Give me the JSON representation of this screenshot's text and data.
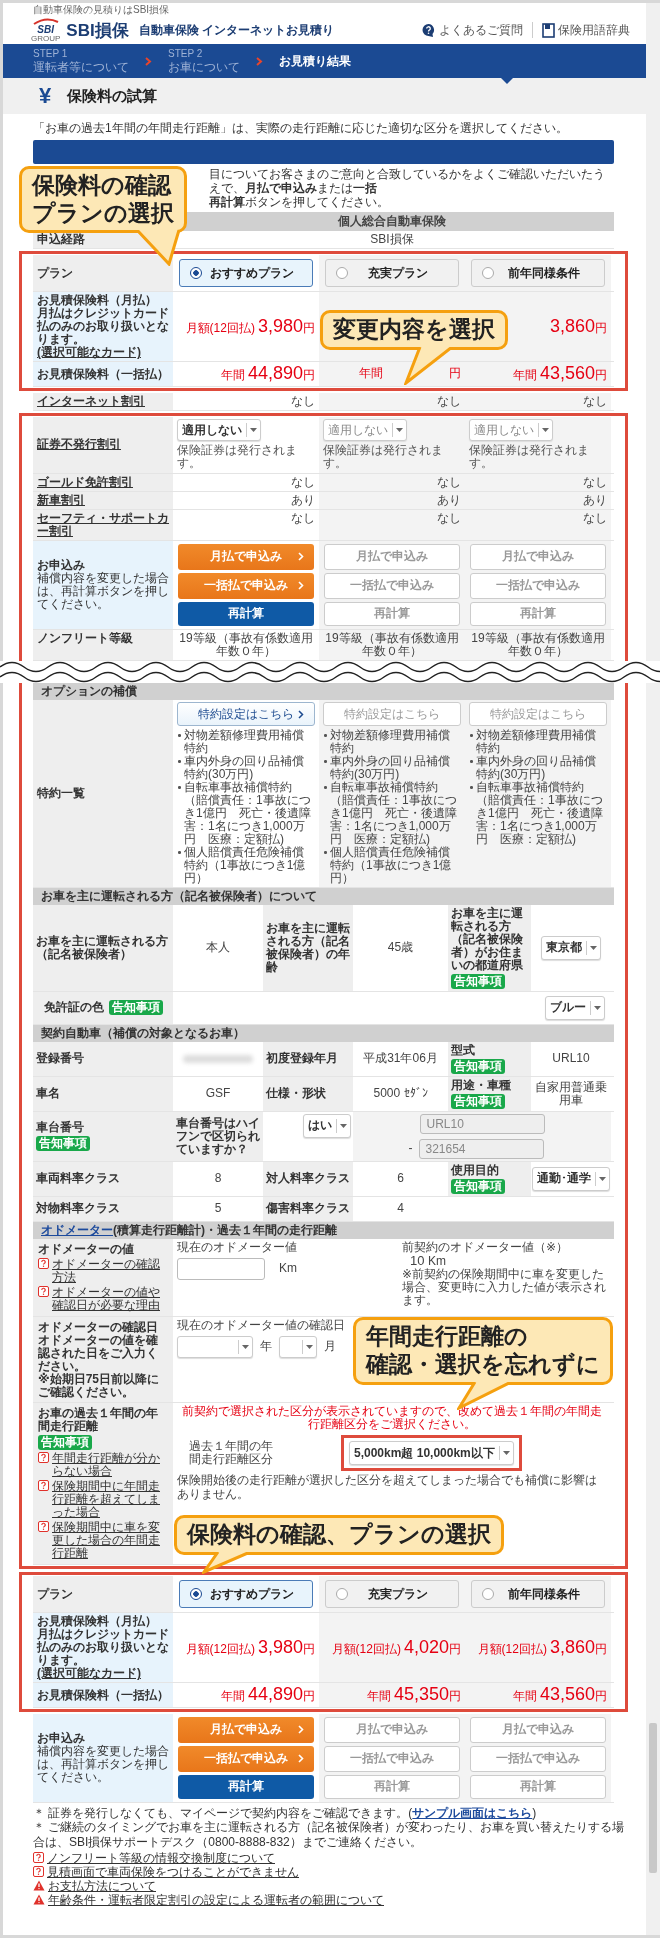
{
  "top_note": "自動車保険の見積りはSBI損保",
  "header": {
    "logo_mark": "SBI",
    "logo_group": "GROUP",
    "brand": "SBI損保",
    "title": "自動車保険 インターネットお見積り",
    "links": [
      {
        "label": "よくあるご質問",
        "kind": "faq"
      },
      {
        "label": "保険用語辞典",
        "kind": "glossary"
      }
    ]
  },
  "steps": [
    {
      "step": "STEP 1",
      "label": "運転者等について",
      "selected": false
    },
    {
      "step": "STEP 2",
      "label": "お車について",
      "selected": false
    },
    {
      "label": "お見積り結果",
      "selected": true
    }
  ],
  "page_title": {
    "icon": "¥",
    "text": "保険料の試算"
  },
  "intro": "「お車の過去1年間の年間走行距離」は、実際の走行距離に応じた適切な区分を選択してください。",
  "notice_lines": [
    "目についてお客さまのご意向と合致しているかをよくご確認いただいたうえで、**月払で申込み**または**一括**",
    "**再計算**ボタンを押してください。"
  ],
  "product_row": {
    "value": "個人総合自動車保険"
  },
  "route_row": {
    "label": "申込経路",
    "value": "SBI損保"
  },
  "plan_top": {
    "label": "プラン",
    "monthly_label": {
      "title": "お見積保険料（月払）",
      "note": "月払はクレジットカード払のみのお取り扱いとなります。",
      "link": "(選択可能なカード)"
    },
    "annual_label": "お見積保険料（一括払）",
    "options": [
      {
        "label": "おすすめプラン",
        "selected": true,
        "monthly": {
          "prefix": "月額",
          "sub": "(12回払)",
          "amount": "3,980",
          "unit": "円"
        },
        "annual": {
          "prefix": "年間",
          "amount": "44,890",
          "unit": "円"
        }
      },
      {
        "label": "充実プラン",
        "selected": false,
        "annual": {
          "prefix": "年間",
          "unit": "円"
        }
      },
      {
        "label": "前年同様条件",
        "selected": false,
        "monthly": {
          "amount": "3,860",
          "unit": "円"
        },
        "annual": {
          "prefix": "年間",
          "amount": "43,560",
          "unit": "円"
        }
      }
    ]
  },
  "internet_row": {
    "label": "インターネット割引",
    "values": [
      "なし",
      "なし",
      "なし"
    ]
  },
  "certificate_row": {
    "label": "証券不発行割引",
    "selects": [
      {
        "value": "適用しない",
        "disabled": false
      },
      {
        "value": "適用しない",
        "disabled": true
      },
      {
        "value": "適用しない",
        "disabled": true
      }
    ],
    "notes": [
      "保険証券は発行されます。",
      "保険証券は発行されます。",
      "保険証券は発行されます。"
    ]
  },
  "discount_rows": [
    {
      "label": "ゴールド免許割引",
      "values": [
        "なし",
        "なし",
        "なし"
      ]
    },
    {
      "label": "新車割引",
      "values": [
        "あり",
        "あり",
        "あり"
      ]
    },
    {
      "label": "セーフティ・サポートカー割引",
      "values": [
        "なし",
        "なし",
        "なし"
      ]
    }
  ],
  "apply_top": {
    "title": "お申込み",
    "note": "補償内容を変更した場合は、再計算ボタンを押してください。",
    "columns": [
      [
        {
          "label": "月払で申込み",
          "kind": "apply",
          "disabled": false
        },
        {
          "label": "一括払で申込み",
          "kind": "apply",
          "disabled": false
        },
        {
          "label": "再計算",
          "kind": "recalc",
          "disabled": false
        }
      ],
      [
        {
          "label": "月払で申込み",
          "kind": "apply",
          "disabled": true
        },
        {
          "label": "一括払で申込み",
          "kind": "apply",
          "disabled": true
        },
        {
          "label": "再計算",
          "kind": "recalc",
          "disabled": true
        }
      ],
      [
        {
          "label": "月払で申込み",
          "kind": "apply",
          "disabled": true
        },
        {
          "label": "一括払で申込み",
          "kind": "apply",
          "disabled": true
        },
        {
          "label": "再計算",
          "kind": "recalc",
          "disabled": true
        }
      ]
    ]
  },
  "grade_row": {
    "label": "ノンフリート等級",
    "values": [
      "19等級（事故有係数適用年数０年）",
      "19等級（事故有係数適用年数０年）",
      "19等級（事故有係数適用年数０年）"
    ]
  },
  "options": {
    "heading": "オプションの補償",
    "label": "特約一覧",
    "columns": [
      {
        "button": {
          "label": "特約設定はこちら",
          "disabled": false
        },
        "items": [
          "対物差額修理費用補償特約",
          "車内外身の回り品補償特約(30万円)",
          "自転車事故補償特約（賠償責任：1事故につき1億円　死亡・後遺障害：1名につき1,000万円　医療：定額払)",
          "個人賠償責任危険補償特約（1事故につき1億円）"
        ]
      },
      {
        "button": {
          "label": "特約設定はこちら",
          "disabled": true
        },
        "items": [
          "対物差額修理費用補償特約",
          "車内外身の回り品補償特約(30万円)",
          "自転車事故補償特約（賠償責任：1事故につき1億円　死亡・後遺障害：1名につき1,000万円　医療：定額払)",
          "個人賠償責任危険補償特約（1事故につき1億円）"
        ]
      },
      {
        "button": {
          "label": "特約設定はこちら",
          "disabled": true
        },
        "items": [
          "対物差額修理費用補償特約",
          "車内外身の回り品補償特約(30万円)",
          "自転車事故補償特約（賠償責任：1事故につき1億円　死亡・後遺障害：1名につき1,000万円　医療：定額払)"
        ]
      }
    ]
  },
  "driver": {
    "heading": "お車を主に運転される方（記名被保険者）について",
    "cells": [
      {
        "kind": "label",
        "text": "お車を主に運転される方（記名被保険者）"
      },
      {
        "kind": "value",
        "text": "本人"
      },
      {
        "kind": "label",
        "text": "お車を主に運転される方（記名被保険者）の年齢"
      },
      {
        "kind": "value",
        "text": "45歳"
      },
      {
        "kind": "label",
        "text": "お車を主に運転される方（記名被保険者）がお住まいの都道府県",
        "badge": "告知事項"
      },
      {
        "kind": "select",
        "value": "東京都"
      }
    ]
  },
  "license": {
    "label": "免許証の色",
    "badge": "告知事項",
    "select": "ブルー"
  },
  "vehicle": {
    "heading": "契約自動車（補償の対象となるお車）",
    "rows": [
      [
        {
          "kind": "label",
          "text": "登録番号"
        },
        {
          "kind": "blurred"
        },
        {
          "kind": "label",
          "text": "初度登録年月"
        },
        {
          "kind": "value",
          "text": "平成31年06月"
        },
        {
          "kind": "label",
          "text": "型式",
          "badge": "告知事項"
        },
        {
          "kind": "value",
          "text": "URL10"
        }
      ],
      [
        {
          "kind": "label",
          "text": "車名"
        },
        {
          "kind": "value",
          "text": "GSF"
        },
        {
          "kind": "label",
          "text": "仕様・形状"
        },
        {
          "kind": "value",
          "text": "5000 ｾﾀﾞﾝ"
        },
        {
          "kind": "label",
          "text": "用途・車種",
          "badge": "告知事項"
        },
        {
          "kind": "value",
          "text": "自家用普通乗用車"
        }
      ],
      [
        {
          "kind": "label",
          "text": "車台番号",
          "badge": "告知事項"
        },
        {
          "kind": "question",
          "text": "車台番号はハイフンで区切られていますか？"
        },
        {
          "kind": "select",
          "value": "はい"
        },
        {
          "kind": "inputs",
          "values": [
            "URL10",
            "321654"
          ],
          "separator": "-",
          "disabled": true
        }
      ],
      [
        {
          "kind": "label",
          "text": "車両料率クラス"
        },
        {
          "kind": "value",
          "text": "8"
        },
        {
          "kind": "label",
          "text": "対人料率クラス"
        },
        {
          "kind": "value",
          "text": "6"
        },
        {
          "kind": "label",
          "text": "使用目的",
          "badge": "告知事項"
        },
        {
          "kind": "select",
          "value": "通勤･通学"
        }
      ],
      [
        {
          "kind": "label",
          "text": "対物料率クラス"
        },
        {
          "kind": "value",
          "text": "5"
        },
        {
          "kind": "label",
          "text": "傷害料率クラス"
        },
        {
          "kind": "value",
          "text": "4"
        }
      ]
    ]
  },
  "odometer": {
    "heading_link": "オドメーター",
    "heading": "(積算走行距離計)・過去１年間の走行距離",
    "value_row": {
      "label": "オドメーターの値",
      "help": [
        "オドメーターの確認方法",
        "オドメーターの値や確認日が必要な理由"
      ],
      "caption": "現在のオドメーター値",
      "unit": "Km",
      "previous": {
        "caption": "前契約のオドメーター値（※）",
        "value": "10",
        "unit": "Km",
        "note": "※前契約の保険期間中に車を変更した場合、変更時に入力した値が表示されます。"
      }
    },
    "date_row": {
      "label": "オドメーターの確認日",
      "desc": "オドメーターの値を確認された日をご入力ください。",
      "note": "※始期日75日前以降にご確認ください。",
      "caption": "現在のオドメーター値の確認日",
      "units": [
        "年",
        "月"
      ]
    },
    "distance_row": {
      "label": "お車の過去１年間の年間走行距離",
      "badge": "告知事項",
      "help": [
        "年間走行距離が分からない場合",
        "保険期間中に年間走行距離を超えてしまった場合",
        "保険期間中に車を変更した場合の年間走行距離"
      ],
      "warning": "前契約で選択された区分が表示されていますので、改めて過去１年間の年間走行距離区分をご選択ください。",
      "caption": "過去１年間の年間走行距離区分",
      "select": "5,000km超 10,000km以下",
      "note": "保険開始後の走行距離が選択した区分を超えてしまった場合でも補償に影響はありません。"
    }
  },
  "plan_bottom": {
    "label": "プラン",
    "monthly_label": {
      "title": "お見積保険料（月払）",
      "note": "月払はクレジットカード払のみのお取り扱いとなります。",
      "link": "(選択可能なカード)"
    },
    "annual_label": "お見積保険料（一括払）",
    "options": [
      {
        "label": "おすすめプラン",
        "selected": true,
        "monthly": {
          "prefix": "月額",
          "sub": "(12回払)",
          "amount": "3,980",
          "unit": "円"
        },
        "annual": {
          "prefix": "年間",
          "amount": "44,890",
          "unit": "円"
        }
      },
      {
        "label": "充実プラン",
        "selected": false,
        "monthly": {
          "prefix": "月額",
          "sub": "(12回払)",
          "amount": "4,020",
          "unit": "円"
        },
        "annual": {
          "prefix": "年間",
          "amount": "45,350",
          "unit": "円"
        }
      },
      {
        "label": "前年同様条件",
        "selected": false,
        "monthly": {
          "prefix": "月額",
          "sub": "(12回払)",
          "amount": "3,860",
          "unit": "円"
        },
        "annual": {
          "prefix": "年間",
          "amount": "43,560",
          "unit": "円"
        }
      }
    ]
  },
  "apply_bottom": {
    "title": "お申込み",
    "note": "補償内容を変更した場合は、再計算ボタンを押してください。",
    "columns": [
      [
        {
          "label": "月払で申込み",
          "kind": "apply",
          "disabled": false
        },
        {
          "label": "一括払で申込み",
          "kind": "apply",
          "disabled": false
        },
        {
          "label": "再計算",
          "kind": "recalc",
          "disabled": false
        }
      ],
      [
        {
          "label": "月払で申込み",
          "kind": "apply",
          "disabled": true
        },
        {
          "label": "一括払で申込み",
          "kind": "apply",
          "disabled": true
        },
        {
          "label": "再計算",
          "kind": "recalc",
          "disabled": true
        }
      ],
      [
        {
          "label": "月払で申込み",
          "kind": "apply",
          "disabled": true
        },
        {
          "label": "一括払で申込み",
          "kind": "apply",
          "disabled": true
        },
        {
          "label": "再計算",
          "kind": "recalc",
          "disabled": true
        }
      ]
    ]
  },
  "notes": [
    {
      "text": "＊ 証券を発行しなくても、マイページで契約内容をご確認できます。(",
      "link": "サンプル画面はこちら",
      "after": ")"
    },
    {
      "text": "＊ ご継続のタイミングでお車を主に運転される方（記名被保険者）が変わったり、お車を買い替えたりする場合は、SBI損保サポートデスク（0800-8888-832）までご連絡ください。"
    }
  ],
  "links": [
    {
      "label": "ノンフリート等級の情報交換制度について",
      "kind": "help"
    },
    {
      "label": "見積画面で車両保険をつけることができません",
      "kind": "help"
    },
    {
      "label": "お支払方法について",
      "kind": "warning"
    },
    {
      "label": "年齢条件・運転者限定割引の設定による運転者の範囲について",
      "kind": "warning"
    }
  ],
  "callouts": [
    {
      "lines": [
        "保険料の確認",
        "プランの選択"
      ]
    },
    {
      "lines": [
        "変更内容を選択"
      ]
    },
    {
      "lines": [
        "年間走行距離の",
        "確認・選択を忘れずに"
      ]
    },
    {
      "lines": [
        "保険料の確認、プランの選択"
      ]
    }
  ]
}
